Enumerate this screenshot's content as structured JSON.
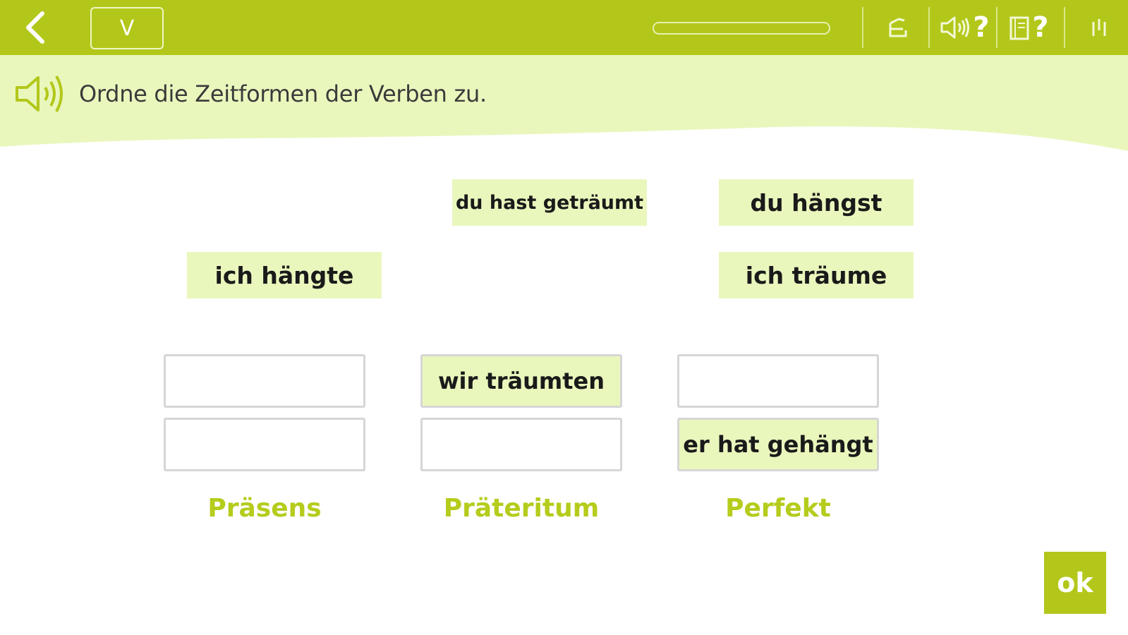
{
  "topbar": {
    "level_label": "V",
    "progress_fraction": 0,
    "icons": {
      "back": "chevron-left-icon",
      "restart": "restart-icon",
      "audio_help": "speaker-help-icon",
      "book_help": "book-help-icon",
      "menu": "menu-icon"
    },
    "help_mark": "?",
    "colors": {
      "bar": "#b3c71a",
      "accent_light": "#e9f7bd",
      "label_green": "#b5cc1c"
    }
  },
  "instruction": {
    "text": "Ordne die Zeitformen der Verben zu."
  },
  "cards": [
    {
      "text": "du hast geträumt",
      "size": "small"
    },
    {
      "text": "du hängst",
      "size": "normal"
    },
    {
      "text": "ich hängte",
      "size": "normal"
    },
    {
      "text": "ich träume",
      "size": "normal"
    }
  ],
  "columns": [
    {
      "label": "Präsens",
      "slots": [
        "",
        ""
      ]
    },
    {
      "label": "Präteritum",
      "slots": [
        "wir träumten",
        ""
      ]
    },
    {
      "label": "Perfekt",
      "slots": [
        "",
        "er hat gehängt"
      ]
    }
  ],
  "ok_label": "ok"
}
